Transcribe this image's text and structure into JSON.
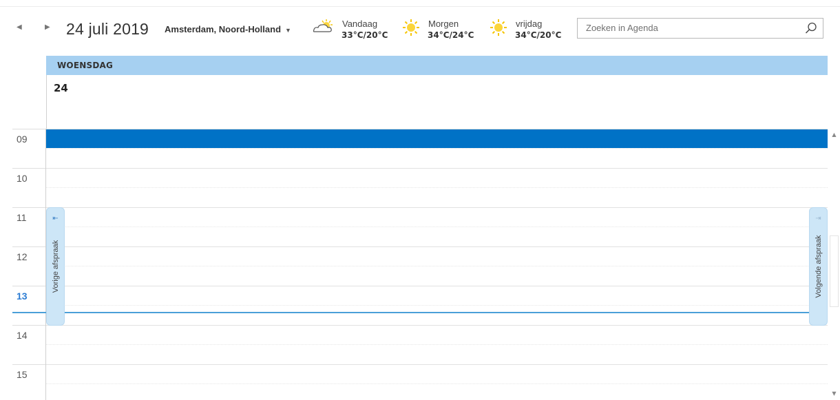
{
  "header": {
    "prev_arrow": "◀",
    "next_arrow": "▶",
    "date_title": "24 juli 2019",
    "location": "Amsterdam, Noord-Holland",
    "location_caret": "▼"
  },
  "weather": [
    {
      "day": "Vandaag",
      "temp": "33°C/20°C",
      "icon": "partly-cloudy-icon"
    },
    {
      "day": "Morgen",
      "temp": "34°C/24°C",
      "icon": "sun-icon"
    },
    {
      "day": "vrijdag",
      "temp": "34°C/20°C",
      "icon": "sun-icon"
    }
  ],
  "search": {
    "placeholder": "Zoeken in Agenda",
    "value": ""
  },
  "day": {
    "name": "WOENSDAG",
    "number": "24"
  },
  "hours": [
    {
      "label": "09",
      "current": false
    },
    {
      "label": "10",
      "current": false
    },
    {
      "label": "11",
      "current": false
    },
    {
      "label": "12",
      "current": false
    },
    {
      "label": "13",
      "current": true
    },
    {
      "label": "14",
      "current": false
    },
    {
      "label": "15",
      "current": false
    }
  ],
  "side_tabs": {
    "previous": "Vorige afspraak",
    "next": "Volgende afspraak"
  },
  "colors": {
    "day_header": "#a6d0f1",
    "selected_slot": "#0072c6",
    "now_line": "#4a9fd8",
    "side_tab": "#cde6f7",
    "current_hour": "#2b7cd3"
  }
}
